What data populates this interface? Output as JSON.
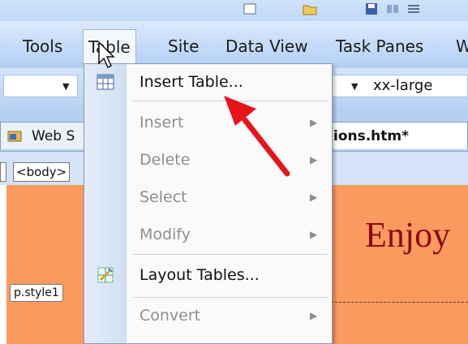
{
  "menu_bar": {
    "items": [
      {
        "label": "Tools"
      },
      {
        "label": "Table"
      },
      {
        "label": "Site"
      },
      {
        "label": "Data View"
      },
      {
        "label": "Task Panes"
      },
      {
        "label": "W"
      }
    ]
  },
  "toolbar": {
    "font_size_value": "xx-large"
  },
  "tabs": [
    {
      "label": "Web S"
    },
    {
      "label": "ions.htm*"
    }
  ],
  "tag_selector": {
    "body_tag": "<body>"
  },
  "page": {
    "heading_text": "Enjoy",
    "style_tag": "p.style1"
  },
  "table_menu": {
    "items": [
      {
        "label": "Insert Table...",
        "enabled": true,
        "submenu": false
      },
      {
        "label": "Insert",
        "enabled": false,
        "submenu": true
      },
      {
        "label": "Delete",
        "enabled": false,
        "submenu": true
      },
      {
        "label": "Select",
        "enabled": false,
        "submenu": true
      },
      {
        "label": "Modify",
        "enabled": false,
        "submenu": true
      },
      {
        "label": "Layout Tables...",
        "enabled": true,
        "submenu": false
      },
      {
        "label": "Convert",
        "enabled": false,
        "submenu": true
      }
    ]
  },
  "colors": {
    "annotation_arrow": "#e8141c",
    "page_background": "#fb9a5f",
    "heading_color": "#8a0b0b"
  },
  "icons": [
    "insert-table-icon",
    "layout-tables-icon",
    "mouse-cursor-icon",
    "web-site-icon"
  ]
}
